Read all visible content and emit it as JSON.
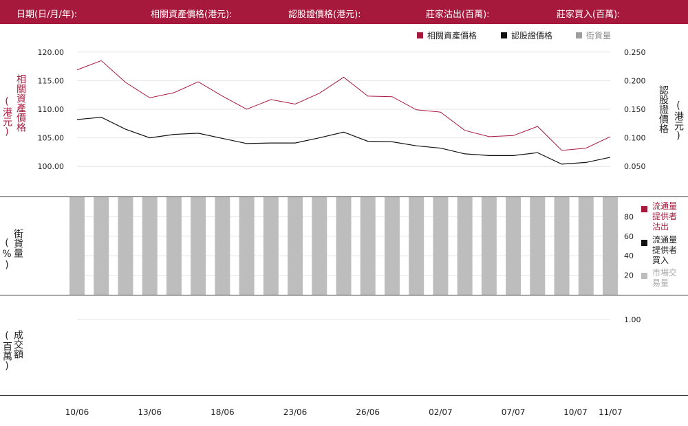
{
  "header": {
    "date_label": "日期(日/月/年):",
    "asset_label": "相關資產價格(港元):",
    "warrant_label": "認股證價格(港元):",
    "sell_label": "莊家沽出(百萬):",
    "buy_label": "莊家買入(百萬):"
  },
  "panels": {
    "price_left_axis_title": "相關資產價格",
    "price_left_axis_unit": "(港元)",
    "price_right_axis_title": "認股證價格",
    "price_right_axis_unit": "(港元)",
    "outstanding_axis_title": "街貨量",
    "outstanding_axis_unit": "(%)",
    "turnover_axis_title": "成交額",
    "turnover_axis_unit": "(百萬)"
  },
  "legend": {
    "asset": "相關資產價格",
    "warrant": "認股證價格",
    "outstanding": "街貨量",
    "lp_sell": "流通量提供者沽出",
    "lp_buy": "流通量提供者買入",
    "market": "市場交易量"
  },
  "colors": {
    "asset": "#a6193c",
    "warrant": "#111111",
    "outstanding": "#bdbdbd",
    "header_bg": "#a6193c"
  },
  "chart_data": [
    {
      "type": "line",
      "panel": "price",
      "x": [
        "10/06",
        "11/06",
        "12/06",
        "13/06",
        "16/06",
        "17/06",
        "18/06",
        "19/06",
        "20/06",
        "23/06",
        "24/06",
        "25/06",
        "26/06",
        "27/06",
        "30/06",
        "02/07",
        "03/07",
        "04/07",
        "07/07",
        "08/07",
        "09/07",
        "10/07",
        "11/07"
      ],
      "xticks": [
        "10/06",
        "13/06",
        "18/06",
        "23/06",
        "26/06",
        "02/07",
        "07/07",
        "10/07",
        "11/07"
      ],
      "series": [
        {
          "name": "相關資產價格",
          "axis": "left",
          "values": [
            116.9,
            118.5,
            114.7,
            112.0,
            112.9,
            114.8,
            112.3,
            110.0,
            111.7,
            110.9,
            112.8,
            115.6,
            112.3,
            112.2,
            109.9,
            109.5,
            106.3,
            105.2,
            105.4,
            107.0,
            102.8,
            103.2,
            105.2
          ]
        },
        {
          "name": "認股證價格",
          "axis": "right",
          "values": [
            0.132,
            0.136,
            0.115,
            0.1,
            0.106,
            0.108,
            0.099,
            0.09,
            0.091,
            0.091,
            0.1,
            0.11,
            0.094,
            0.093,
            0.086,
            0.082,
            0.072,
            0.069,
            0.069,
            0.074,
            0.054,
            0.057,
            0.066
          ]
        }
      ],
      "left_ylim": [
        97.5,
        122.5
      ],
      "left_yticks": [
        "100.00",
        "105.00",
        "110.00",
        "115.00",
        "120.00"
      ],
      "right_ylim": [
        0.025,
        0.275
      ],
      "right_yticks": [
        "0.050",
        "0.100",
        "0.150",
        "0.200",
        "0.250"
      ]
    },
    {
      "type": "bar",
      "panel": "outstanding",
      "x": [
        "10/06",
        "11/06",
        "12/06",
        "13/06",
        "16/06",
        "17/06",
        "18/06",
        "19/06",
        "20/06",
        "23/06",
        "24/06",
        "25/06",
        "26/06",
        "27/06",
        "30/06",
        "02/07",
        "03/07",
        "04/07",
        "07/07",
        "08/07",
        "09/07",
        "10/07",
        "11/07"
      ],
      "series": [
        {
          "name": "街貨量",
          "values": [
            100,
            100,
            100,
            100,
            100,
            100,
            100,
            100,
            100,
            100,
            100,
            100,
            100,
            100,
            100,
            100,
            100,
            100,
            100,
            100,
            100,
            100,
            100
          ]
        }
      ],
      "ylim": [
        0,
        100
      ],
      "yticks": [
        "20",
        "40",
        "60",
        "80"
      ]
    },
    {
      "type": "bar",
      "panel": "turnover",
      "yticks": [
        "1.00"
      ]
    }
  ]
}
